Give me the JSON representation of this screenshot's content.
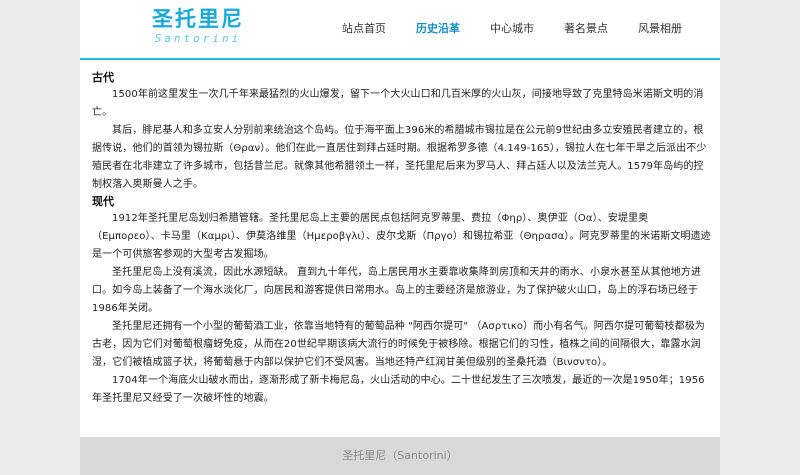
{
  "header": {
    "logo_cn": "圣托里尼",
    "logo_en": "Santorini",
    "nav": [
      {
        "label": "站点首页",
        "active": false
      },
      {
        "label": "历史沿革",
        "active": true
      },
      {
        "label": "中心城市",
        "active": false
      },
      {
        "label": "著名景点",
        "active": false
      },
      {
        "label": "风景相册",
        "active": false
      }
    ]
  },
  "sections": [
    {
      "title": "古代",
      "paragraphs": [
        "1500年前这里发生一次几千年来最猛烈的火山爆发，留下一个大火山口和几百米厚的火山灰，间接地导致了克里特岛米诺斯文明的消亡。",
        "其后，腓尼基人和多立安人分别前来统治这个岛屿。位于海平面上396米的希腊城市锡拉是在公元前9世纪由多立安殖民者建立的，根据传说，他们的首领为锡拉斯（Θραν）。他们在此一直居住到拜占廷时期。根据希罗多德（4.149-165），锡拉人在七年干旱之后派出不少殖民者在北非建立了许多城市，包括昔兰尼。就像其他希腊领土一样，圣托里尼后来为罗马人、拜占廷人以及法兰克人。1579年岛屿的控制权落入奥斯曼人之手。"
      ]
    },
    {
      "title": "现代",
      "paragraphs": [
        "1912年圣托里尼岛划归希腊管辖。圣托里尼岛上主要的居民点包括阿克罗蒂里、费拉（Φηρ）、奥伊亚（Οα）、安堤里奥（Εμπορεο）、卡马里（Καμρι）、伊莫洛维里（Ημεροβγλι）、皮尔戈斯（Πργο）和锡拉希亚（Θηρασα）。阿克罗蒂里的米诺斯文明遗迹是一个可供旅客参观的大型考古发掘场。",
        "圣托里尼岛上没有溪流，因此水源短缺。 直到九十年代，岛上居民用水主要靠收集降到房顶和天井的雨水、小泉水甚至从其他地方进口。如今岛上装备了一个海水淡化厂，向居民和游客提供日常用水。岛上的主要经济是旅游业，为了保护破火山口，岛上的浮石场已经于1986年关闭。",
        "圣托里尼还拥有一个小型的葡萄酒工业，依靠当地特有的葡萄品种 \"阿西尔提可\" （Ασρτικο）而小有名气。阿西尔提可葡萄枝都极为古老，因为它们对葡萄根瘤蚜免疫，从而在20世纪早期该病大流行的时候免于被移除。根据它们的习性，植株之间的间隔很大，靠露水润湿，它们被植成篮子状，将葡萄悬于内部以保护它们不受风害。当地还特产红润甘美但级别的圣桑托酒（Βινσντο）。",
        "1704年一个海底火山破水而出，逐渐形成了新卡梅尼岛，火山活动的中心。二十世纪发生了三次喷发，最近的一次是1950年；1956年圣托里尼又经受了一次破坏性的地震。"
      ]
    }
  ],
  "footer": {
    "text": "圣托里尼（Santorini）"
  }
}
